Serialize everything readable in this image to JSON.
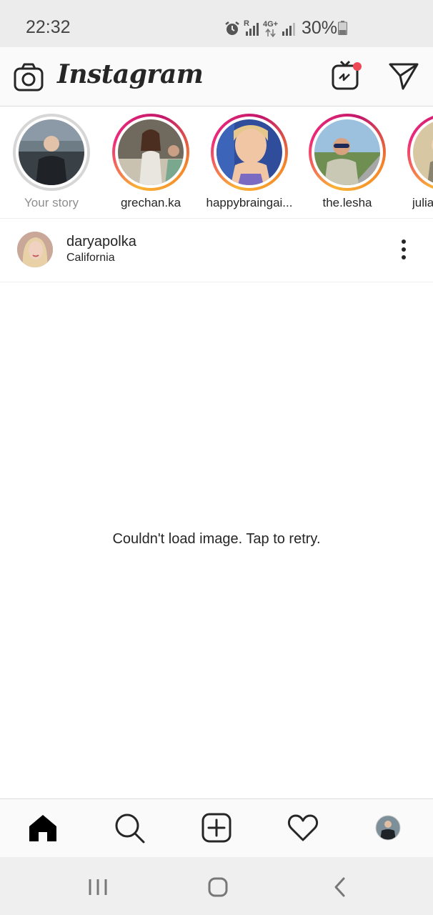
{
  "status_bar": {
    "time": "22:32",
    "battery": "30%",
    "icons": [
      "alarm-icon",
      "signal-icon",
      "4g-icon",
      "signal-icon",
      "battery-icon"
    ],
    "network_label": "4G+",
    "roaming_label": "R"
  },
  "header": {
    "logo": "Instagram",
    "icons": [
      "camera-icon",
      "igtv-icon",
      "direct-message-icon"
    ],
    "notification_color": "#ed4956"
  },
  "stories": [
    {
      "username": "Your story",
      "seen": true
    },
    {
      "username": "grechan.ka",
      "seen": false
    },
    {
      "username": "happybraingai...",
      "seen": false
    },
    {
      "username": "the.lesha",
      "seen": false
    },
    {
      "username": "julia",
      "seen": false
    }
  ],
  "post": {
    "username": "daryapolka",
    "location": "California",
    "error_message": "Couldn't load image. Tap to retry."
  },
  "tab_bar": {
    "items": [
      "home-icon",
      "search-icon",
      "add-post-icon",
      "activity-heart-icon",
      "profile-avatar"
    ]
  },
  "nav_bar": {
    "items": [
      "recent-apps-icon",
      "home-button-icon",
      "back-icon"
    ]
  },
  "colors": {
    "story_gradient": [
      "#f9b233",
      "#ee2a7b",
      "#c2186b"
    ],
    "text": "#262626",
    "secondary_text": "#8e8e8e"
  }
}
